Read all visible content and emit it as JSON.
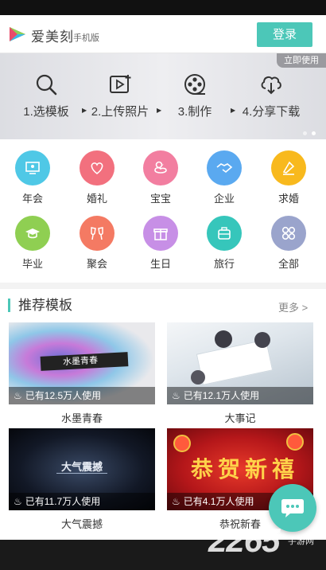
{
  "header": {
    "brand": "爱美刻",
    "brand_sub": "手机版",
    "login_label": "登录"
  },
  "banner": {
    "tag": "立即使用",
    "steps": [
      {
        "label": "1.选模板",
        "icon": "search-icon"
      },
      {
        "label": "2.上传照片",
        "icon": "upload-photo-icon"
      },
      {
        "label": "3.制作",
        "icon": "film-reel-icon"
      },
      {
        "label": "4.分享下载",
        "icon": "cloud-download-icon"
      }
    ]
  },
  "categories": [
    {
      "label": "年会",
      "color": "#4fc8e6",
      "icon": "monitor-icon"
    },
    {
      "label": "婚礼",
      "color": "#f2707e",
      "icon": "heart-icon"
    },
    {
      "label": "宝宝",
      "color": "#f27ea0",
      "icon": "duck-icon"
    },
    {
      "label": "企业",
      "color": "#5aa9f0",
      "icon": "handshake-icon"
    },
    {
      "label": "求婚",
      "color": "#f8b91d",
      "icon": "ring-icon"
    },
    {
      "label": "毕业",
      "color": "#8fcf52",
      "icon": "graduation-cap-icon"
    },
    {
      "label": "聚会",
      "color": "#f47a63",
      "icon": "cheers-icon"
    },
    {
      "label": "生日",
      "color": "#c78fe6",
      "icon": "gift-icon"
    },
    {
      "label": "旅行",
      "color": "#36c6bb",
      "icon": "luggage-icon"
    },
    {
      "label": "全部",
      "color": "#9aa4cc",
      "icon": "grid-icon"
    }
  ],
  "recommend": {
    "title": "推荐模板",
    "more": "更多 >",
    "cards": [
      {
        "title": "水墨青春",
        "usage": "已有12.5万人使用",
        "thumb_text": "水墨青春"
      },
      {
        "title": "大事记",
        "usage": "已有12.1万人使用",
        "thumb_text": ""
      },
      {
        "title": "大气震撼",
        "usage": "已有11.7万人使用",
        "thumb_text": "大气震撼"
      },
      {
        "title": "恭祝新春",
        "usage": "已有4.1万人使用",
        "thumb_text": "恭贺新禧"
      }
    ]
  },
  "watermark": {
    "main": "2265",
    "sub": "手游网"
  },
  "colors": {
    "accent": "#4cc7b8"
  }
}
